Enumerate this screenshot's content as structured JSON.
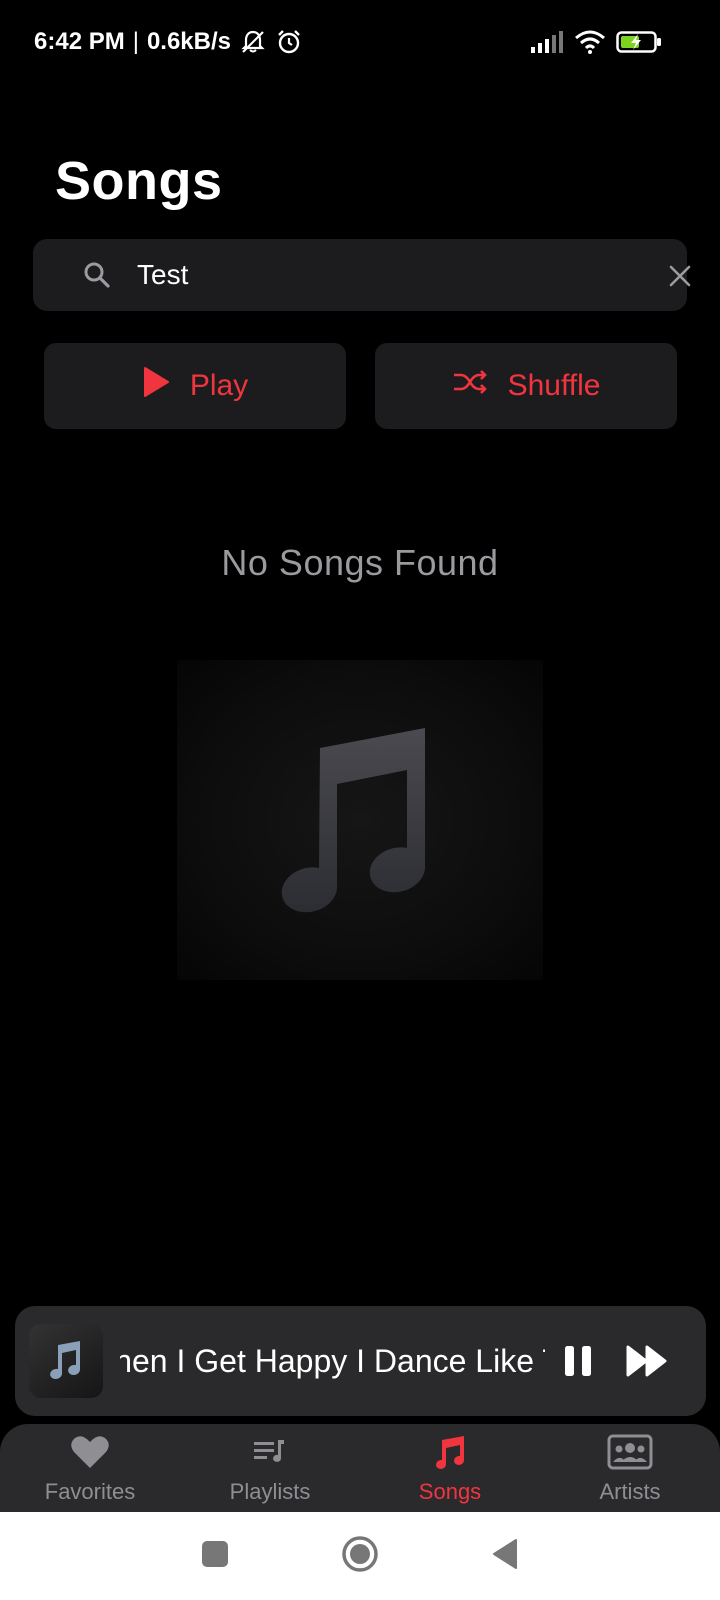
{
  "status_bar": {
    "time": "6:42 PM",
    "separator": "|",
    "network_speed": "0.6kB/s",
    "icons": [
      "notifications-off-icon",
      "alarm-icon",
      "signal-icon",
      "wifi-icon",
      "battery-charging-icon"
    ]
  },
  "page": {
    "title": "Songs"
  },
  "search": {
    "value": "Test",
    "placeholder": "Search"
  },
  "actions": {
    "play_label": "Play",
    "shuffle_label": "Shuffle"
  },
  "empty_state": {
    "message": "No Songs Found",
    "icon": "music-note-icon"
  },
  "mini_player": {
    "title": "When I Get Happy I Dance Like This",
    "visible_title": "n I Get Happy I Dance Lik",
    "state": "playing"
  },
  "bottom_nav": {
    "items": [
      {
        "label": "Favorites",
        "icon": "heart-icon",
        "active": false
      },
      {
        "label": "Playlists",
        "icon": "playlist-icon",
        "active": false
      },
      {
        "label": "Songs",
        "icon": "music-note-icon",
        "active": true
      },
      {
        "label": "Artists",
        "icon": "artists-icon",
        "active": false
      }
    ]
  },
  "colors": {
    "accent": "#f0353f",
    "background": "#000000",
    "surface": "#1c1c1e",
    "muted_text": "#9a9a9f"
  }
}
